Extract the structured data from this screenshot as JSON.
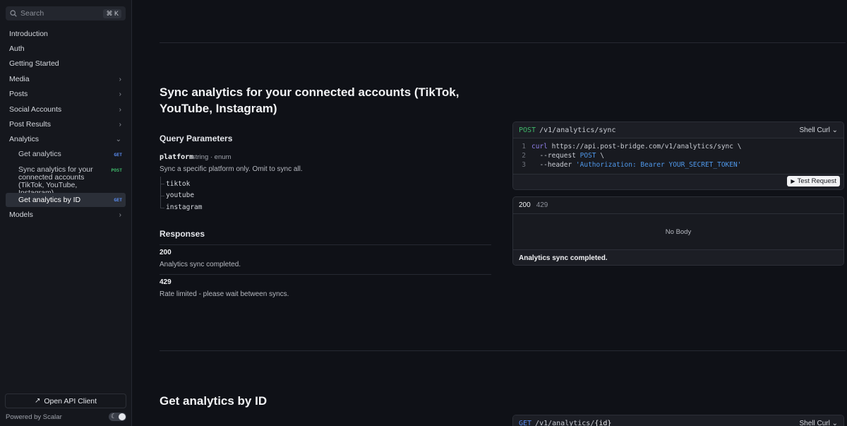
{
  "search": {
    "placeholder": "Search",
    "shortcut": "⌘ K"
  },
  "sidebar": {
    "items": [
      {
        "label": "Introduction"
      },
      {
        "label": "Auth"
      },
      {
        "label": "Getting Started"
      },
      {
        "label": "Media"
      },
      {
        "label": "Posts"
      },
      {
        "label": "Social Accounts"
      },
      {
        "label": "Post Results"
      },
      {
        "label": "Analytics"
      },
      {
        "label": "Models"
      }
    ],
    "analytics_children": [
      {
        "label": "Get analytics",
        "method": "GET"
      },
      {
        "label": "Sync analytics for your connected accounts (TikTok, YouTube, Instagram)",
        "method": "POST"
      },
      {
        "label": "Get analytics by ID",
        "method": "GET"
      }
    ],
    "open_client": "Open API Client",
    "powered_by": "Powered by Scalar"
  },
  "section1": {
    "title": "Sync analytics for your connected accounts (TikTok, YouTube, Instagram)",
    "query_heading": "Query Parameters",
    "param": {
      "name": "platform",
      "type": "string · enum",
      "description": "Sync a specific platform only. Omit to sync all.",
      "enum": [
        "tiktok",
        "youtube",
        "instagram"
      ]
    },
    "responses_heading": "Responses",
    "responses": [
      {
        "code": "200",
        "description": "Analytics sync completed."
      },
      {
        "code": "429",
        "description": "Rate limited - please wait between syncs."
      }
    ],
    "request": {
      "method": "POST",
      "path": "/v1/analytics/sync",
      "lang": "Shell Curl",
      "lines": [
        {
          "n": "1",
          "pre": "curl",
          "rest": " https://api.post-bridge.com/v1/analytics/sync \\"
        },
        {
          "n": "2",
          "pre": "  --request ",
          "kw": "POST",
          "rest": " \\"
        },
        {
          "n": "3",
          "pre": "  --header ",
          "str": "'Authorization: Bearer YOUR_SECRET_TOKEN'"
        }
      ],
      "test_button": "Test Request"
    },
    "response_panel": {
      "tabs": [
        "200",
        "429"
      ],
      "body": "No Body",
      "footer": "Analytics sync completed."
    }
  },
  "section2": {
    "title": "Get analytics by ID",
    "request": {
      "method": "GET",
      "path_prefix": "/v1/analytics/",
      "path_param": "{id}",
      "lang": "Shell Curl"
    }
  },
  "colors": {
    "background": "#0f1117",
    "post": "#3fb96a",
    "get": "#5a8cf0",
    "keyword": "#8f7ee8",
    "string": "#4f98ea"
  },
  "icons": {
    "search": "search-icon",
    "chevron": "chevron-right-icon",
    "play": "play-icon",
    "external": "arrow-up-right-icon",
    "theme": "moon-icon"
  }
}
